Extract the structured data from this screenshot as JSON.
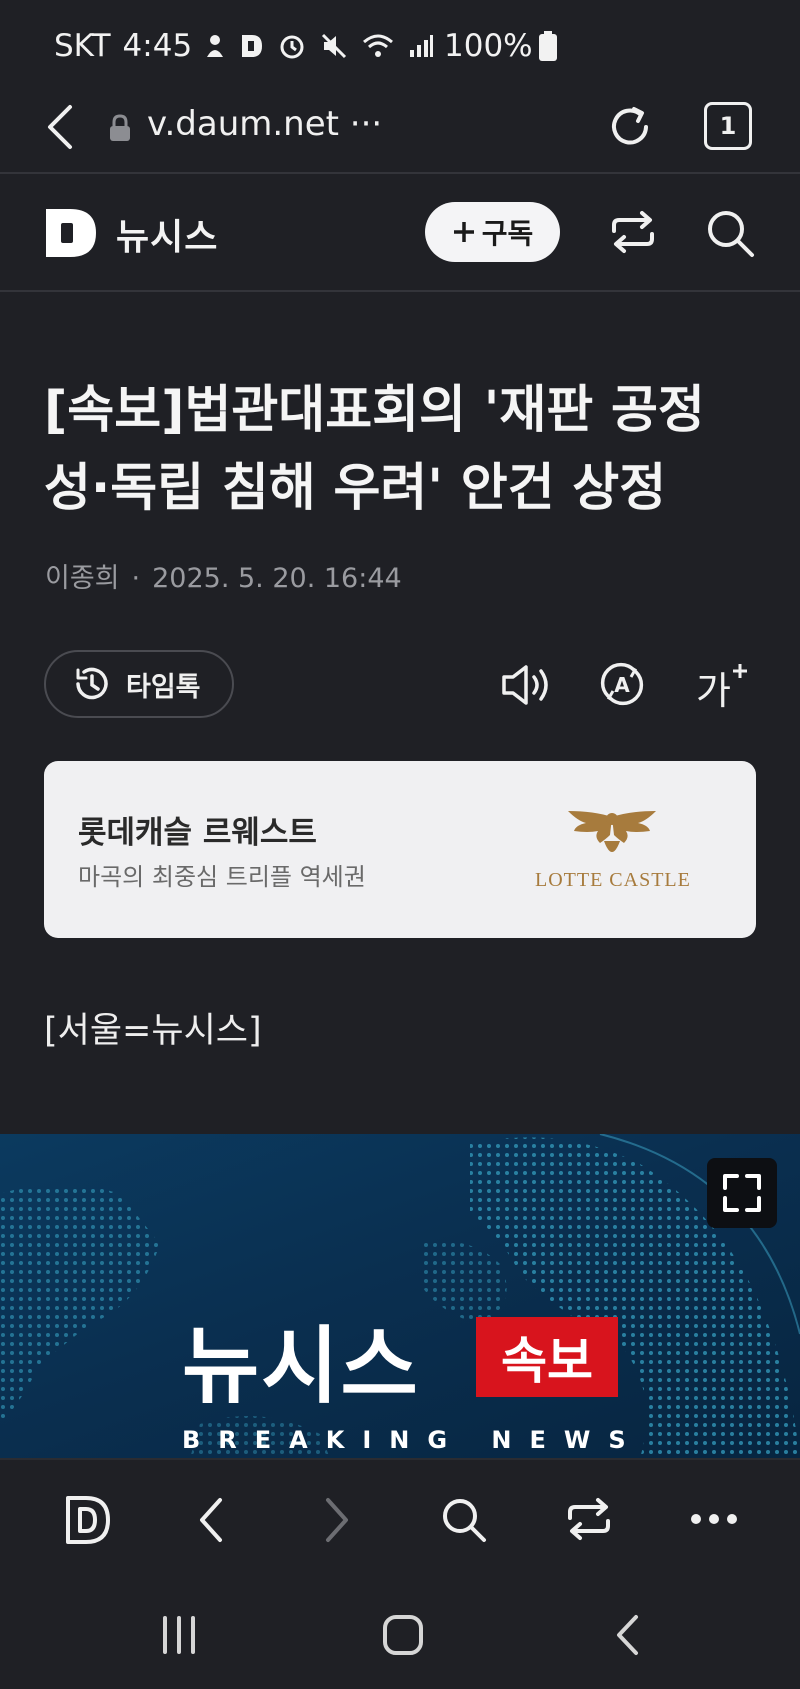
{
  "status_bar": {
    "carrier": "SKT",
    "time": "4:45",
    "battery": "100%"
  },
  "browser": {
    "url": "v.daum.net ···",
    "tab_count": "1"
  },
  "news_header": {
    "brand": "뉴시스",
    "subscribe_label": "구독"
  },
  "article": {
    "headline_line1": "[속보]법관대표회의 '재판 공정",
    "headline_line2": "성·독립 침해 우려' 안건 상정",
    "author": "이종희",
    "datetime": "2025. 5. 20. 16:44",
    "timetalk_label": "타임톡",
    "font_size_label": "가",
    "body_line": "[서울=뉴시스]"
  },
  "ad": {
    "title": "롯데캐슬 르웨스트",
    "subtitle": "마곡의 최중심 트리플 역세권",
    "logo_text": "LOTTE CASTLE"
  },
  "image": {
    "brand": "뉴시스",
    "badge": "속보",
    "caption": "BREAKING NEWS"
  },
  "colors": {
    "background": "#1f2025",
    "badge_red": "#d8141d",
    "ad_gold": "#a77b3d"
  },
  "icons": [
    "back-icon",
    "lock-icon",
    "reload-icon",
    "tabs-icon",
    "daum-logo-icon",
    "plus-icon",
    "share-icon",
    "search-icon",
    "clock-icon",
    "speaker-icon",
    "translate-icon",
    "font-size-icon",
    "fullscreen-icon",
    "forward-icon",
    "more-icon",
    "recent-apps-icon",
    "home-icon"
  ]
}
